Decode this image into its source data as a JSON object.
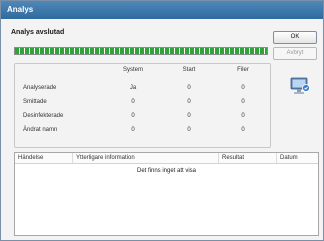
{
  "window": {
    "title": "Analys"
  },
  "heading": "Analys avslutad",
  "buttons": {
    "ok": "OK",
    "abort": "Avbryt"
  },
  "progress": {
    "fraction": 1.0,
    "color": "#2fa43a"
  },
  "stats": {
    "columns": [
      "System",
      "Start",
      "Filer"
    ],
    "rows": [
      {
        "label": "Analyserade",
        "values": [
          "Ja",
          "0",
          "0"
        ]
      },
      {
        "label": "Smittade",
        "values": [
          "0",
          "0",
          "0"
        ]
      },
      {
        "label": "Desinfekterade",
        "values": [
          "0",
          "0",
          "0"
        ]
      },
      {
        "label": "Ändrat namn",
        "values": [
          "0",
          "0",
          "0"
        ]
      }
    ]
  },
  "computer_icon": "computer-monitor-icon",
  "list": {
    "columns": [
      "Händelse",
      "Ytterligare information",
      "Resultat",
      "Datum"
    ],
    "empty_text": "Det finns inget att visa"
  }
}
